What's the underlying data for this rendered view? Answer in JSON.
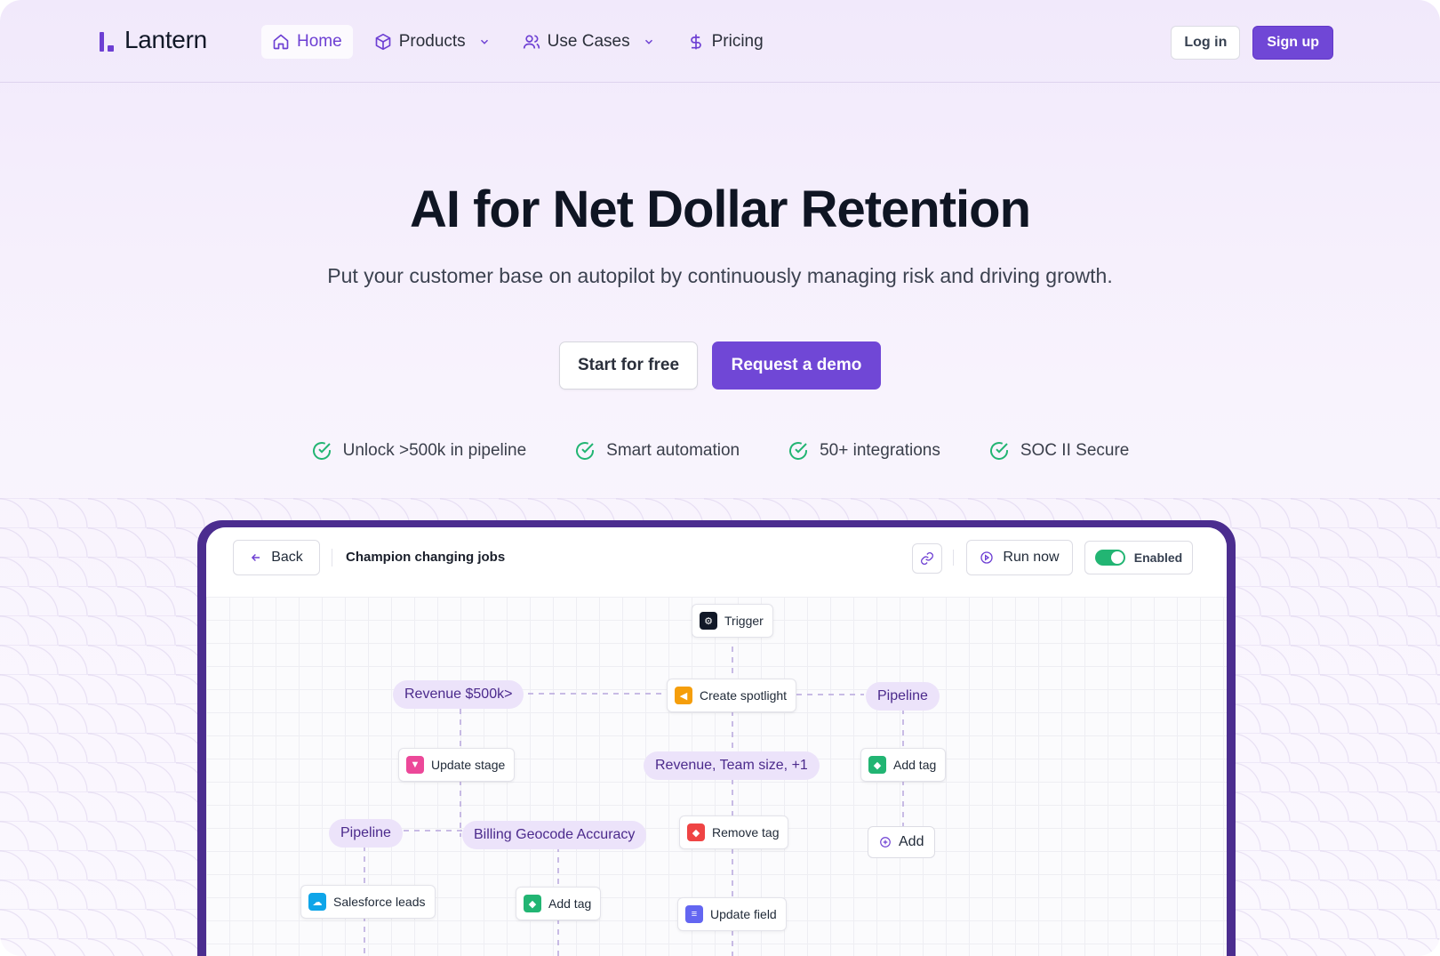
{
  "brand": {
    "name": "Lantern",
    "accent": "#7047d6"
  },
  "nav": {
    "items": [
      {
        "label": "Home",
        "icon": "home-icon",
        "active": true
      },
      {
        "label": "Products",
        "icon": "cube-icon",
        "has_dropdown": true
      },
      {
        "label": "Use Cases",
        "icon": "users-icon",
        "has_dropdown": true
      },
      {
        "label": "Pricing",
        "icon": "dollar-icon"
      }
    ],
    "login_label": "Log in",
    "signup_label": "Sign up"
  },
  "hero": {
    "title": "AI for Net Dollar Retention",
    "subtitle": "Put your customer base on autopilot by continuously managing risk and driving growth.",
    "cta_primary": "Request a demo",
    "cta_secondary": "Start for free",
    "features": [
      "Unlock >500k in pipeline",
      "Smart automation",
      "50+ integrations",
      "SOC II Secure"
    ]
  },
  "app": {
    "back_label": "Back",
    "workflow_title": "Champion changing jobs",
    "run_label": "Run now",
    "enabled_label": "Enabled",
    "enabled": true,
    "nodes": {
      "trigger": "Trigger",
      "create_spotlight": "Create spotlight",
      "update_stage": "Update stage",
      "add_tag_right": "Add tag",
      "remove_tag": "Remove tag",
      "salesforce_leads": "Salesforce leads",
      "add_tag_bottom": "Add tag",
      "update_field": "Update field",
      "add": "Add"
    },
    "conditions": {
      "revenue_500k": "Revenue $500k>",
      "pipeline_right": "Pipeline",
      "revenue_team": "Revenue, Team size, +1",
      "pipeline_left": "Pipeline",
      "billing": "Billing Geocode Accuracy"
    }
  }
}
